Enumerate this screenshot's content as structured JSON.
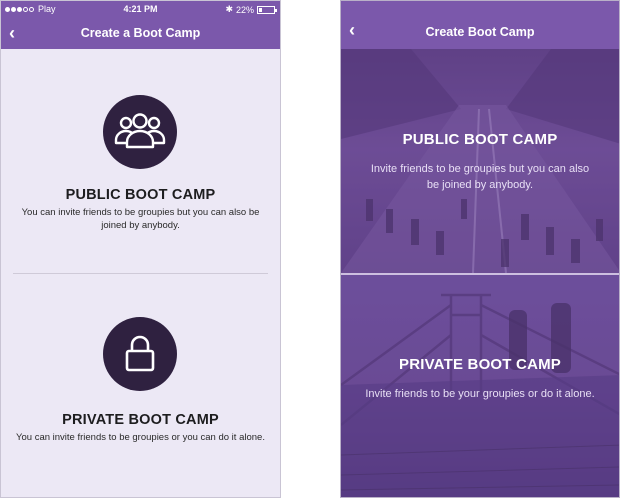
{
  "left_screen": {
    "statusbar": {
      "carrier": "Play",
      "time": "4:21 PM",
      "bluetooth": "✱",
      "battery_percent": "22%",
      "battery_level": 0.22
    },
    "navbar": {
      "back": "‹",
      "title": "Create a Boot Camp"
    },
    "public_option": {
      "icon": "group-icon",
      "title": "PUBLIC BOOT CAMP",
      "description": "You can invite friends to be groupies but you can also be joined by anybody."
    },
    "private_option": {
      "icon": "lock-icon",
      "title": "PRIVATE BOOT CAMP",
      "description": "You can invite friends to be groupies or you can do it alone."
    }
  },
  "right_screen": {
    "navbar": {
      "back": "‹",
      "title": "Create Boot Camp"
    },
    "public_panel": {
      "background": "runners-street-photo",
      "title": "PUBLIC BOOT CAMP",
      "description": "Invite friends to be groupies but you can also be joined by anybody."
    },
    "private_panel": {
      "background": "bridge-runners-photo",
      "title": "PRIVATE BOOT CAMP",
      "description": "Invite friends to be your groupies or do it alone."
    }
  },
  "colors": {
    "accent": "#7b58ab",
    "icon_circle": "#2f2140",
    "background": "#ece8f5",
    "overlay": "#6b4b93"
  }
}
